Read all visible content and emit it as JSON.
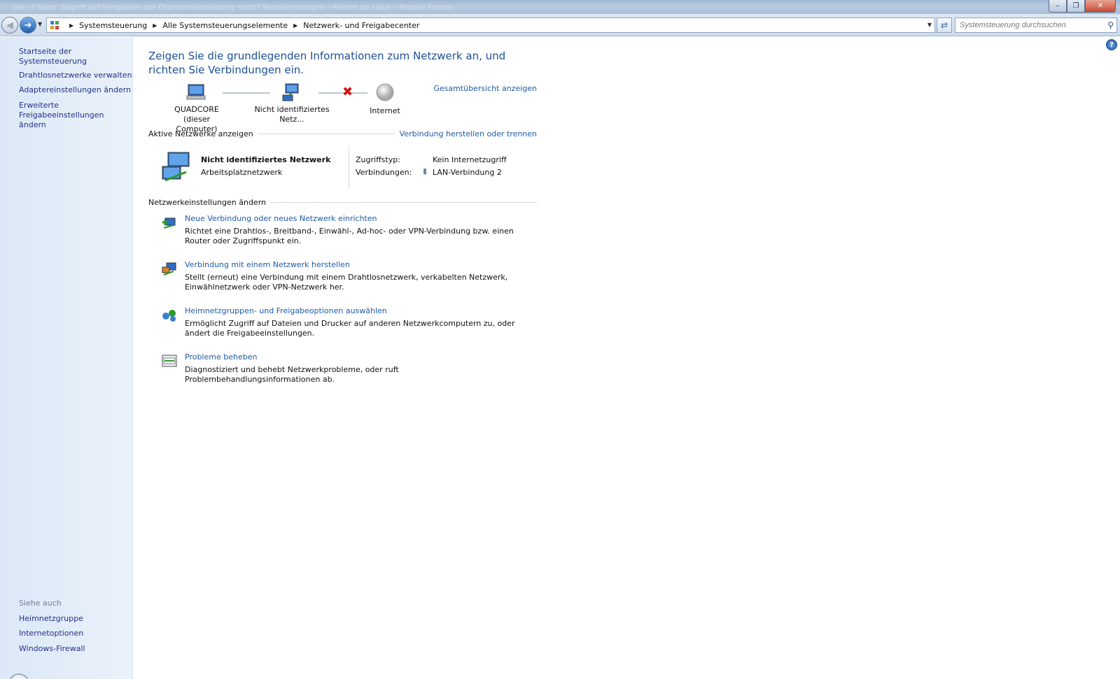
{
  "window": {
    "title_faint": "Win-7 Gast: Zugriff auf Freigaben der Drahtlosverbindung nicht? Netzwerkfragen – Forum de Luxe – Mozilla Firefox",
    "minimize": "–",
    "maximize": "❐",
    "close": "✕"
  },
  "addressbar": {
    "breadcrumbs": [
      "Systemsteuerung",
      "Alle Systemsteuerungselemente",
      "Netzwerk- und Freigabecenter"
    ],
    "search_placeholder": "Systemsteuerung durchsuchen"
  },
  "sidebar": {
    "home": "Startseite der Systemsteuerung",
    "items": [
      "Drahtlosnetzwerke verwalten",
      "Adaptereinstellungen ändern",
      "Erweiterte Freigabeeinstellungen ändern"
    ],
    "see_also_title": "Siehe auch",
    "see_also": [
      "Heimnetzgruppe",
      "Internetoptionen",
      "Windows-Firewall"
    ]
  },
  "main": {
    "heading": "Zeigen Sie die grundlegenden Informationen zum Netzwerk an, und richten Sie Verbindungen ein.",
    "full_map_link": "Gesamtübersicht anzeigen",
    "map_nodes": [
      {
        "line1": "QUADCORE",
        "line2": "(dieser Computer)"
      },
      {
        "line1": "Nicht identifiziertes Netz...",
        "line2": ""
      },
      {
        "line1": "Internet",
        "line2": ""
      }
    ],
    "active_section_title": "Aktive Netzwerke anzeigen",
    "connect_link": "Verbindung herstellen oder trennen",
    "active_network": {
      "name": "Nicht identifiziertes Netzwerk",
      "type": "Arbeitsplatznetzwerk",
      "access_label": "Zugriffstyp:",
      "access_value": "Kein Internetzugriff",
      "connections_label": "Verbindungen:",
      "connections_value": "LAN-Verbindung 2"
    },
    "settings_section_title": "Netzwerkeinstellungen ändern",
    "tasks": [
      {
        "title": "Neue Verbindung oder neues Netzwerk einrichten",
        "desc": "Richtet eine Drahtlos-, Breitband-, Einwähl-, Ad-hoc- oder VPN-Verbindung bzw. einen Router oder Zugriffspunkt ein.",
        "icon": "new-connection-icon"
      },
      {
        "title": "Verbindung mit einem Netzwerk herstellen",
        "desc": "Stellt (erneut) eine Verbindung mit einem Drahtlosnetzwerk, verkabelten Netzwerk, Einwählnetzwerk oder VPN-Netzwerk her.",
        "icon": "connect-network-icon"
      },
      {
        "title": "Heimnetzgruppen- und Freigabeoptionen auswählen",
        "desc": "Ermöglicht Zugriff auf Dateien und Drucker auf anderen Netzwerkcomputern zu, oder ändert die Freigabeeinstellungen.",
        "icon": "homegroup-icon"
      },
      {
        "title": "Probleme beheben",
        "desc": "Diagnostiziert und behebt Netzwerkprobleme, oder ruft Problembehandlungsinformationen ab.",
        "icon": "troubleshoot-icon"
      }
    ]
  },
  "colors": {
    "link": "#1e5aa8",
    "heading": "#1e4f96",
    "sidebar_link": "#1e3287"
  }
}
